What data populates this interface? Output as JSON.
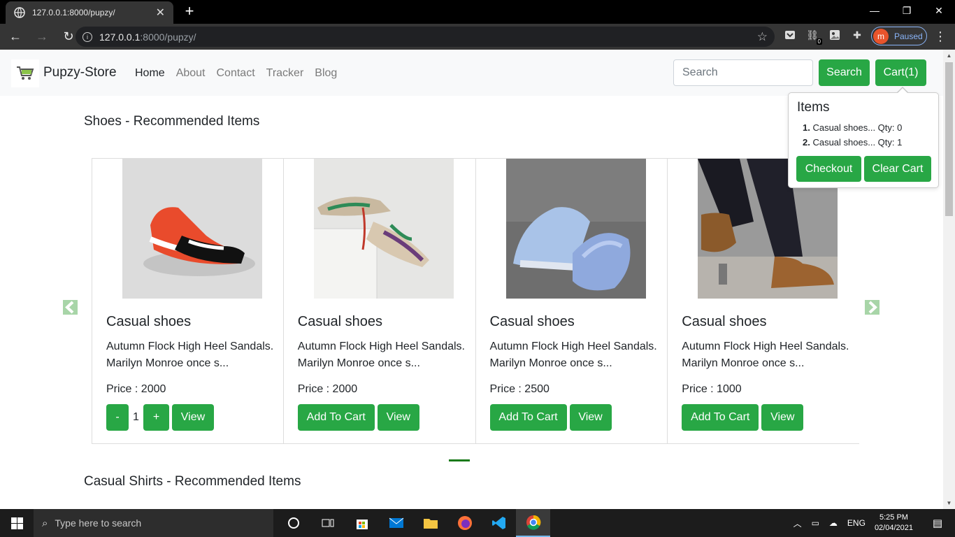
{
  "browser": {
    "tab_title": "127.0.0.1:8000/pupzy/",
    "url_host": "127.0.0.1",
    "url_rest": ":8000/pupzy/",
    "ext_badge": "0",
    "profile_initial": "m",
    "profile_status": "Paused"
  },
  "site": {
    "brand": "Pupzy-Store",
    "nav": [
      "Home",
      "About",
      "Contact",
      "Tracker",
      "Blog"
    ],
    "search_placeholder": "Search",
    "search_button": "Search",
    "cart_button": "Cart(1)"
  },
  "cart_popover": {
    "title": "Items",
    "items": [
      {
        "num": "1.",
        "text": " Casual shoes... Qty: 0"
      },
      {
        "num": "2.",
        "text": " Casual shoes... Qty: 1"
      }
    ],
    "checkout": "Checkout",
    "clear": "Clear Cart"
  },
  "sections": {
    "shoes_title": "Shoes - Recommended Items",
    "shirts_title": "Casual Shirts - Recommended Items"
  },
  "products": [
    {
      "title": "Casual shoes",
      "desc": "Autumn Flock High Heel Sandals. Marilyn Monroe once s...",
      "price": "Price : 2000",
      "qty": "1",
      "minus": "-",
      "plus": "+",
      "view": "View"
    },
    {
      "title": "Casual shoes",
      "desc": "Autumn Flock High Heel Sandals. Marilyn Monroe once s...",
      "price": "Price : 2000",
      "add": "Add To Cart",
      "view": "View"
    },
    {
      "title": "Casual shoes",
      "desc": "Autumn Flock High Heel Sandals. Marilyn Monroe once s...",
      "price": "Price : 2500",
      "add": "Add To Cart",
      "view": "View"
    },
    {
      "title": "Casual shoes",
      "desc": "Autumn Flock High Heel Sandals. Marilyn Monroe once s...",
      "price": "Price : 1000",
      "add": "Add To Cart",
      "view": "View"
    }
  ],
  "taskbar": {
    "search_text": "Type here to search",
    "lang": "ENG",
    "time": "5:25 PM",
    "date": "02/04/2021"
  },
  "colors": {
    "accent_green": "#28a745",
    "nav_bg": "#f8f9fa"
  }
}
